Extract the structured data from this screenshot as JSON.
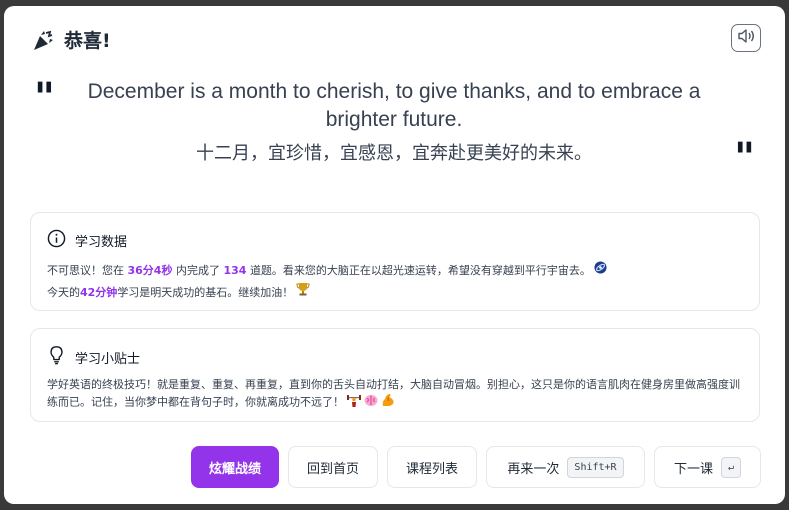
{
  "header": {
    "title": "恭喜!"
  },
  "quote": {
    "open_mark": "\"",
    "close_mark": "\"",
    "english": "December is a month to cherish, to give thanks, and to embrace a brighter future.",
    "chinese": "十二月，宜珍惜，宜感恩，宜奔赴更美好的未来。"
  },
  "stats": {
    "title": "学习数据",
    "line1_prefix": "不可思议！您在",
    "duration": "36分4秒",
    "line1_mid": "内完成了",
    "count": "134",
    "line1_suffix": "道题。看来您的大脑正在以超光速运转，希望没有穿越到平行宇宙去。",
    "line2_today": "今天的",
    "today_minutes": "42分钟",
    "line2_suffix": "学习是明天成功的基石。继续加油！"
  },
  "tips": {
    "title": "学习小贴士",
    "text": "学好英语的终极技巧！就是重复、重复、再重复，直到你的舌头自动打结，大脑自动冒烟。别担心，这只是你的语言肌肉在健身房里做高强度训练而已。记住，当你梦中都在背句子时，你就离成功不远了！"
  },
  "actions": {
    "show_off": "炫耀战绩",
    "home": "回到首页",
    "course_list": "课程列表",
    "retry": "再来一次",
    "retry_shortcut": "Shift+R",
    "next": "下一课",
    "next_shortcut": "↵"
  },
  "colors": {
    "accent": "#9333ea"
  },
  "icons": [
    "party-popper-icon",
    "speaker-icon",
    "info-icon",
    "lightbulb-icon",
    "galaxy-icon",
    "trophy-icon",
    "weightlifter-icon",
    "brain-icon",
    "flexed-biceps-icon"
  ]
}
